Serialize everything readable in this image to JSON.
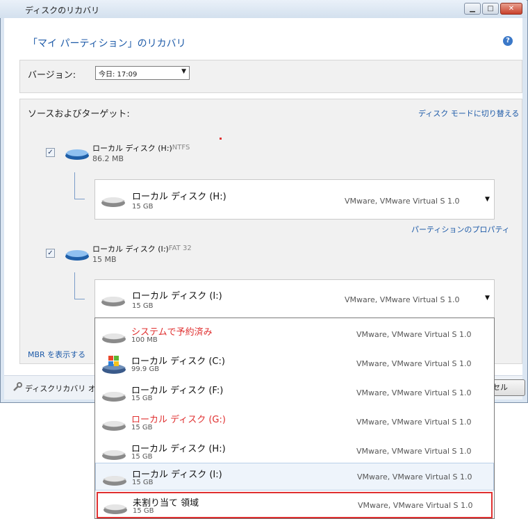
{
  "window": {
    "title": "ディスクのリカバリ",
    "controls": {
      "minimize": "▁",
      "maximize": "□",
      "close": "✕"
    }
  },
  "header": {
    "title": "「マイ パーティション」のリカバリ",
    "help_icon": "help-icon"
  },
  "version": {
    "label": "バージョン:",
    "selected": "今日: 17:09"
  },
  "source_target": {
    "label": "ソースおよびターゲット:",
    "switch_link": "ディスク モードに切り替える",
    "partition_properties_link": "パーティションのプロパティ",
    "sources": [
      {
        "checked": true,
        "name": "ローカル ディスク (H:)",
        "fs": "- NTFS",
        "size": "86.2 MB"
      },
      {
        "checked": true,
        "name": "ローカル ディスク (I:)",
        "fs": "- FAT 32",
        "size": "15 MB"
      }
    ],
    "targets": [
      {
        "name": "ローカル ディスク (H:)",
        "size": "15 GB",
        "vendor": "VMware, VMware Virtual S 1.0"
      },
      {
        "name": "ローカル ディスク (I:)",
        "size": "15 GB",
        "vendor": "VMware, VMware Virtual S 1.0"
      }
    ]
  },
  "mbr_link": "MBR を表示する",
  "footer": {
    "options_link": "ディスクリカバリ オ",
    "cancel_partial": "セル"
  },
  "dropdown_items": [
    {
      "name": "システムで予約済み",
      "size": "100 MB",
      "vendor": "VMware, VMware Virtual S 1.0",
      "name_color": "#e03030",
      "icon": "hard-drive-icon"
    },
    {
      "name": "ローカル ディスク (C:)",
      "size": "99.9 GB",
      "vendor": "VMware, VMware Virtual S 1.0",
      "name_color": "#111111",
      "icon": "windows-drive-icon"
    },
    {
      "name": "ローカル ディスク (F:)",
      "size": "15 GB",
      "vendor": "VMware, VMware Virtual S 1.0",
      "name_color": "#111111",
      "icon": "hard-drive-icon"
    },
    {
      "name": "ローカル ディスク (G:)",
      "size": "15 GB",
      "vendor": "VMware, VMware Virtual S 1.0",
      "name_color": "#e03030",
      "icon": "hard-drive-icon"
    },
    {
      "name": "ローカル ディスク (H:)",
      "size": "15 GB",
      "vendor": "VMware, VMware Virtual S 1.0",
      "name_color": "#111111",
      "icon": "hard-drive-icon"
    },
    {
      "name": "ローカル ディスク (I:)",
      "size": "15 GB",
      "vendor": "VMware, VMware Virtual S 1.0",
      "name_color": "#111111",
      "icon": "hard-drive-icon",
      "selected": true
    },
    {
      "name": "未割り当て 領域",
      "size": "15 GB",
      "vendor": "VMware, VMware Virtual S 1.0",
      "name_color": "#111111",
      "icon": "hard-drive-icon",
      "highlighted": true
    }
  ],
  "colors": {
    "accent": "#1d5aa8",
    "warning": "#e03030",
    "highlight_border": "#e03030"
  }
}
